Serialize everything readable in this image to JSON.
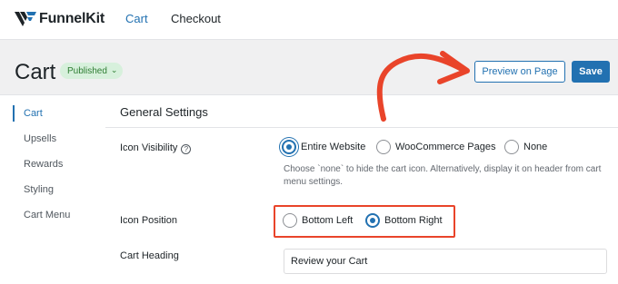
{
  "brand": {
    "logo_text_funnel": "Funnel",
    "logo_text_kit": "Kit"
  },
  "nav": {
    "tabs": [
      {
        "label": "Cart",
        "active": true
      },
      {
        "label": "Checkout",
        "active": false
      }
    ]
  },
  "header": {
    "title": "Cart",
    "status_badge": "Published",
    "preview_button": "Preview on Page",
    "save_button": "Save"
  },
  "sidebar": {
    "items": [
      {
        "label": "Cart",
        "active": true
      },
      {
        "label": "Upsells"
      },
      {
        "label": "Rewards"
      },
      {
        "label": "Styling"
      },
      {
        "label": "Cart Menu"
      }
    ]
  },
  "settings": {
    "section_title": "General Settings",
    "icon_visibility": {
      "label": "Icon Visibility",
      "help_icon": "question-circle-icon",
      "options": [
        "Entire Website",
        "WooCommerce Pages",
        "None"
      ],
      "selected": "Entire Website",
      "help_text": "Choose `none` to hide the cart icon. Alternatively, display it on header from cart menu settings."
    },
    "icon_position": {
      "label": "Icon Position",
      "options": [
        "Bottom Left",
        "Bottom Right"
      ],
      "selected": "Bottom Right"
    },
    "cart_heading": {
      "label": "Cart Heading",
      "value": "Review your Cart"
    }
  },
  "colors": {
    "accent": "#2271b1",
    "annotation_red": "#e9442a",
    "badge_bg": "#d7f0dc",
    "badge_text": "#2e7d32"
  }
}
